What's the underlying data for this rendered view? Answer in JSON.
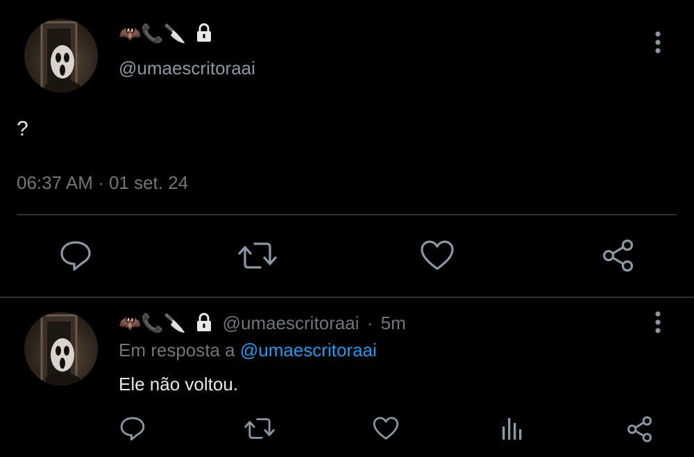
{
  "tweet": {
    "name_emojis": "🦇📞🔪",
    "handle": "@umaescritoraai",
    "text": "?",
    "timestamp": "06:37 AM · 01 set. 24",
    "actions": [
      "reply-icon",
      "retweet-icon",
      "like-icon",
      "share-icon"
    ]
  },
  "reply": {
    "name_emojis": "🦇📞🔪",
    "handle": "@umaescritoraai",
    "separator": "·",
    "time": "5m",
    "in_reply_prefix": "Em resposta a",
    "in_reply_handle": "@umaescritoraai",
    "text": "Ele não voltou.",
    "actions": [
      "reply-icon",
      "retweet-icon",
      "like-icon",
      "analytics-icon",
      "share-icon"
    ]
  },
  "colors": {
    "background": "#000000",
    "text": "#e7e9ea",
    "muted": "#71767b",
    "mention": "#1d9bf0",
    "divider": "#2f3336"
  }
}
